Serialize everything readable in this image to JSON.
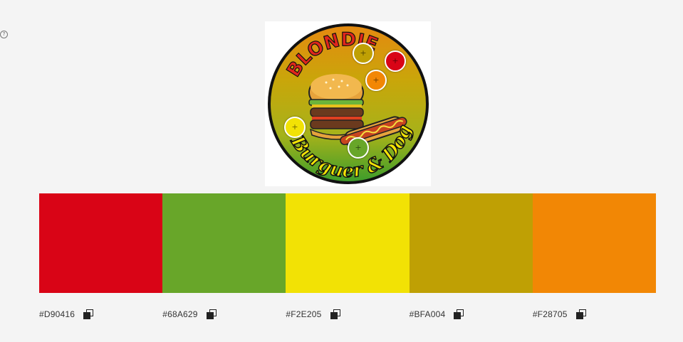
{
  "help": {
    "glyph": "?"
  },
  "logo": {
    "title_text": "BLONDIE",
    "subtitle_text": "Burguer & Dog"
  },
  "palette": {
    "swatches": [
      {
        "hex": "#D90416",
        "color": "#D90416"
      },
      {
        "hex": "#68A629",
        "color": "#68A629"
      },
      {
        "hex": "#F2E205",
        "color": "#F2E205"
      },
      {
        "hex": "#BFA004",
        "color": "#BFA004"
      },
      {
        "hex": "#F28705",
        "color": "#F28705"
      }
    ],
    "pickers": [
      {
        "color": "#BFA004"
      },
      {
        "color": "#D90416"
      },
      {
        "color": "#F28705"
      },
      {
        "color": "#F2E205"
      },
      {
        "color": "#68A629"
      }
    ]
  }
}
